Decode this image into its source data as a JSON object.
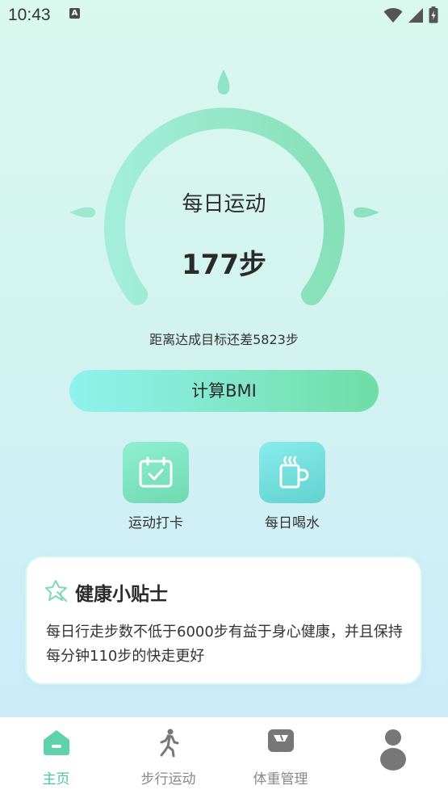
{
  "status_bar": {
    "time": "10:43",
    "notification_icon": "a-icon",
    "icons": [
      "wifi-icon",
      "signal-icon",
      "battery-icon"
    ]
  },
  "gauge": {
    "title": "每日运动",
    "steps": "177步",
    "progress_fraction": 0.03
  },
  "remaining_text": "距离达成目标还差5823步",
  "bmi_button_label": "计算BMI",
  "quick_actions": [
    {
      "label": "运动打卡",
      "icon": "calendar-check-icon",
      "color": "#7ee0bf"
    },
    {
      "label": "每日喝水",
      "icon": "cup-icon",
      "color": "#74d8d8"
    }
  ],
  "tips": {
    "title": "健康小贴士",
    "icon": "star-icon",
    "body": "每日行走步数不低于6000步有益于身心健康，并且保持每分钟110步的快走更好"
  },
  "bottom_nav": [
    {
      "label": "主页",
      "icon": "home-icon",
      "active": true
    },
    {
      "label": "步行运动",
      "icon": "walking-icon",
      "active": false
    },
    {
      "label": "体重管理",
      "icon": "scale-icon",
      "active": false
    },
    {
      "label": "",
      "icon": "profile-icon",
      "active": false
    }
  ],
  "colors": {
    "accent": "#48c99f",
    "gauge_arc": "#8ee6c4"
  }
}
